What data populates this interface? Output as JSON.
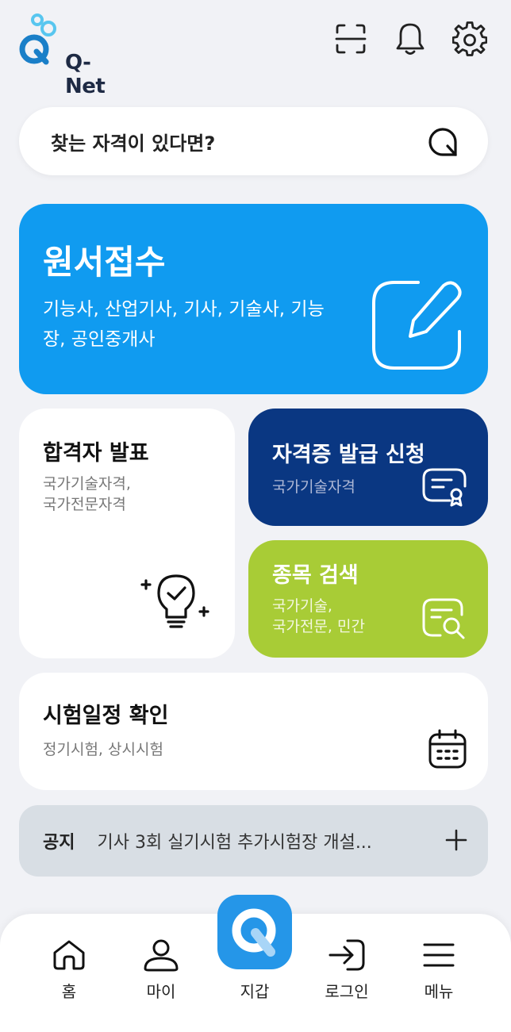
{
  "header": {
    "logo_text": "Q-Net",
    "icons": [
      "scan-icon",
      "bell-icon",
      "gear-icon"
    ]
  },
  "search": {
    "placeholder": "찾는 자격이 있다면?"
  },
  "cards": {
    "apply": {
      "title": "원서접수",
      "desc": "기능사, 산업기사, 기사, 기술사, 기능장, 공인중개사"
    },
    "result": {
      "title": "합격자 발표",
      "desc_line1": "국가기술자격,",
      "desc_line2": "국가전문자격"
    },
    "certificate": {
      "title": "자격증 발급 신청",
      "desc": "국가기술자격"
    },
    "find": {
      "title": "종목 검색",
      "desc_line1": "국가기술,",
      "desc_line2": "국가전문, 민간"
    },
    "schedule": {
      "title": "시험일정 확인",
      "desc": "정기시험, 상시시험"
    }
  },
  "notice": {
    "tag": "공지",
    "text": "기사 3회 실기시험 추가시험장 개설..."
  },
  "bottom_nav": {
    "home": "홈",
    "my": "마이",
    "wallet": "지갑",
    "login": "로그인",
    "menu": "메뉴"
  },
  "colors": {
    "background": "#f1f2f6",
    "apply_card": "#109bf0",
    "cert_card": "#0a3782",
    "find_card": "#a8cc36",
    "notice_bg": "#d8dee4",
    "wallet": "#2596e8"
  }
}
